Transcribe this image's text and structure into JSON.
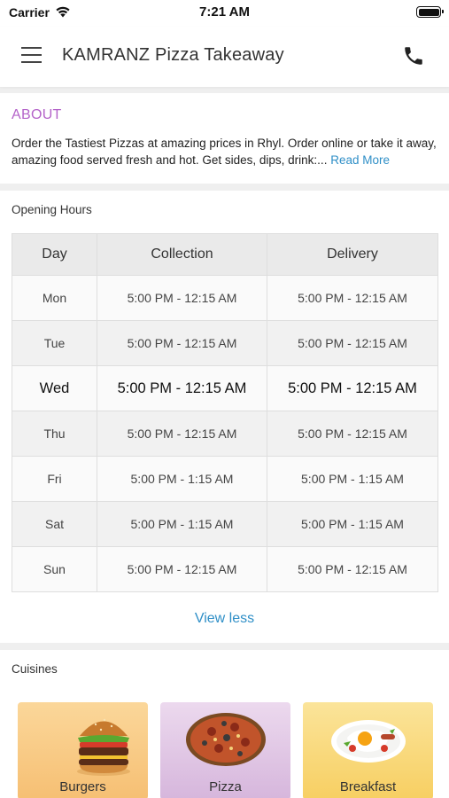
{
  "status_bar": {
    "carrier": "Carrier",
    "time": "7:21 AM"
  },
  "header": {
    "title": "KAMRANZ Pizza Takeaway",
    "menu_icon": "hamburger-menu-icon",
    "phone_icon": "phone-icon"
  },
  "about": {
    "title": "ABOUT",
    "text": "Order the Tastiest Pizzas at amazing prices in Rhyl. Order online or take it away, amazing food served fresh and hot. Get sides, dips, drink:...",
    "read_more": "Read More"
  },
  "opening_hours": {
    "title": "Opening Hours",
    "columns": [
      "Day",
      "Collection",
      "Delivery"
    ],
    "rows": [
      {
        "day": "Mon",
        "collection": "5:00 PM - 12:15 AM",
        "delivery": "5:00 PM - 12:15 AM"
      },
      {
        "day": "Tue",
        "collection": "5:00 PM - 12:15 AM",
        "delivery": "5:00 PM - 12:15 AM"
      },
      {
        "day": "Wed",
        "collection": "5:00 PM - 12:15 AM",
        "delivery": "5:00 PM - 12:15 AM"
      },
      {
        "day": "Thu",
        "collection": "5:00 PM - 12:15 AM",
        "delivery": "5:00 PM - 12:15 AM"
      },
      {
        "day": "Fri",
        "collection": "5:00 PM - 1:15 AM",
        "delivery": "5:00 PM - 1:15 AM"
      },
      {
        "day": "Sat",
        "collection": "5:00 PM - 1:15 AM",
        "delivery": "5:00 PM - 1:15 AM"
      },
      {
        "day": "Sun",
        "collection": "5:00 PM - 12:15 AM",
        "delivery": "5:00 PM - 12:15 AM"
      }
    ],
    "view_less": "View less"
  },
  "cuisines": {
    "title": "Cuisines",
    "items": [
      {
        "label": "Burgers",
        "icon": "burger-icon"
      },
      {
        "label": "Pizza",
        "icon": "pizza-icon"
      },
      {
        "label": "Breakfast",
        "icon": "breakfast-icon"
      }
    ]
  },
  "colors": {
    "accent_purple": "#b463c9",
    "link_blue": "#2f8fc7"
  }
}
